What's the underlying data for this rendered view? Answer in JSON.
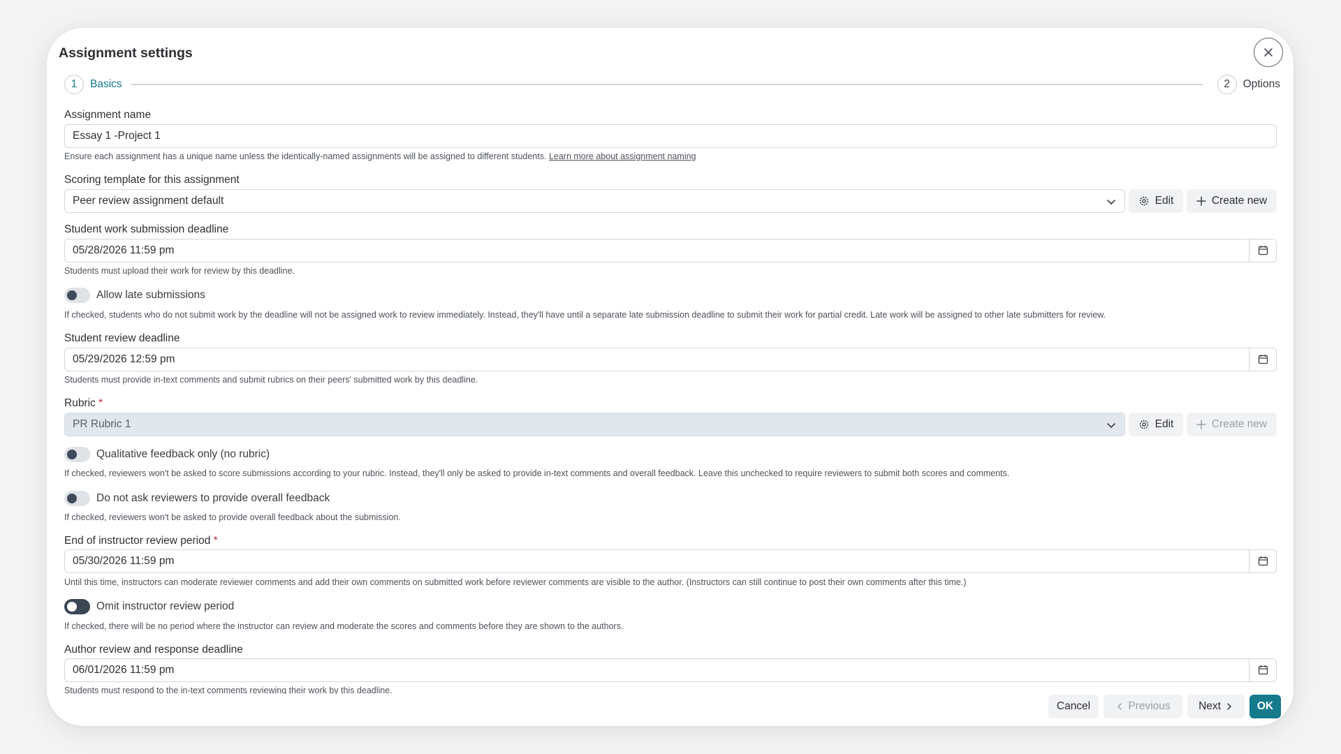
{
  "modal": {
    "title": "Assignment settings",
    "close_icon": "close-icon"
  },
  "stepper": {
    "steps": [
      {
        "number": "1",
        "label": "Basics",
        "active": true
      },
      {
        "number": "2",
        "label": "Options",
        "active": false
      }
    ]
  },
  "fields": {
    "assignment_name": {
      "label": "Assignment name",
      "value": "Essay 1 -Project 1",
      "help": "Ensure each assignment has a unique name unless the identically-named assignments will be assigned to different students.",
      "help_link": "Learn more about assignment naming"
    },
    "scoring_template": {
      "label": "Scoring template for this assignment",
      "value": "Peer review assignment default",
      "edit_label": "Edit",
      "create_label": "Create new"
    },
    "submission_deadline": {
      "label": "Student work submission deadline",
      "value": "05/28/2026 11:59 pm",
      "help": "Students must upload their work for review by this deadline."
    },
    "allow_late": {
      "label": "Allow late submissions",
      "checked": false,
      "help": "If checked, students who do not submit work by the deadline will not be assigned work to review immediately. Instead, they'll have until a separate late submission deadline to submit their work for partial credit. Late work will be assigned to other late submitters for review."
    },
    "review_deadline": {
      "label": "Student review deadline",
      "value": "05/29/2026 12:59 pm",
      "help": "Students must provide in-text comments and submit rubrics on their peers' submitted work by this deadline."
    },
    "rubric": {
      "label": "Rubric",
      "required_mark": "*",
      "value": "PR Rubric 1",
      "edit_label": "Edit",
      "create_label": "Create new"
    },
    "qualitative_only": {
      "label": "Qualitative feedback only (no rubric)",
      "checked": false,
      "help": "If checked, reviewers won't be asked to score submissions according to your rubric. Instead, they'll only be asked to provide in-text comments and overall feedback. Leave this unchecked to require reviewers to submit both scores and comments."
    },
    "no_overall_feedback": {
      "label": "Do not ask reviewers to provide overall feedback",
      "checked": false,
      "help": "If checked, reviewers won't be asked to provide overall feedback about the submission."
    },
    "instructor_review_end": {
      "label": "End of instructor review period",
      "required_mark": "*",
      "value": "05/30/2026 11:59 pm",
      "help": "Until this time, instructors can moderate reviewer comments and add their own comments on submitted work before reviewer comments are visible to the author. (Instructors can still continue to post their own comments after this time.)"
    },
    "omit_instructor_review": {
      "label": "Omit instructor review period",
      "checked": false,
      "help": "If checked, there will be no period where the instructor can review and moderate the scores and comments before they are shown to the authors."
    },
    "author_deadline": {
      "label": "Author review and response deadline",
      "value": "06/01/2026 11:59 pm",
      "help": "Students must respond to the in-text comments reviewing their work by this deadline."
    }
  },
  "footer": {
    "cancel": "Cancel",
    "previous": "Previous",
    "next": "Next",
    "ok": "OK"
  },
  "colors": {
    "accent": "#157a8c",
    "required": "#c5283d"
  }
}
